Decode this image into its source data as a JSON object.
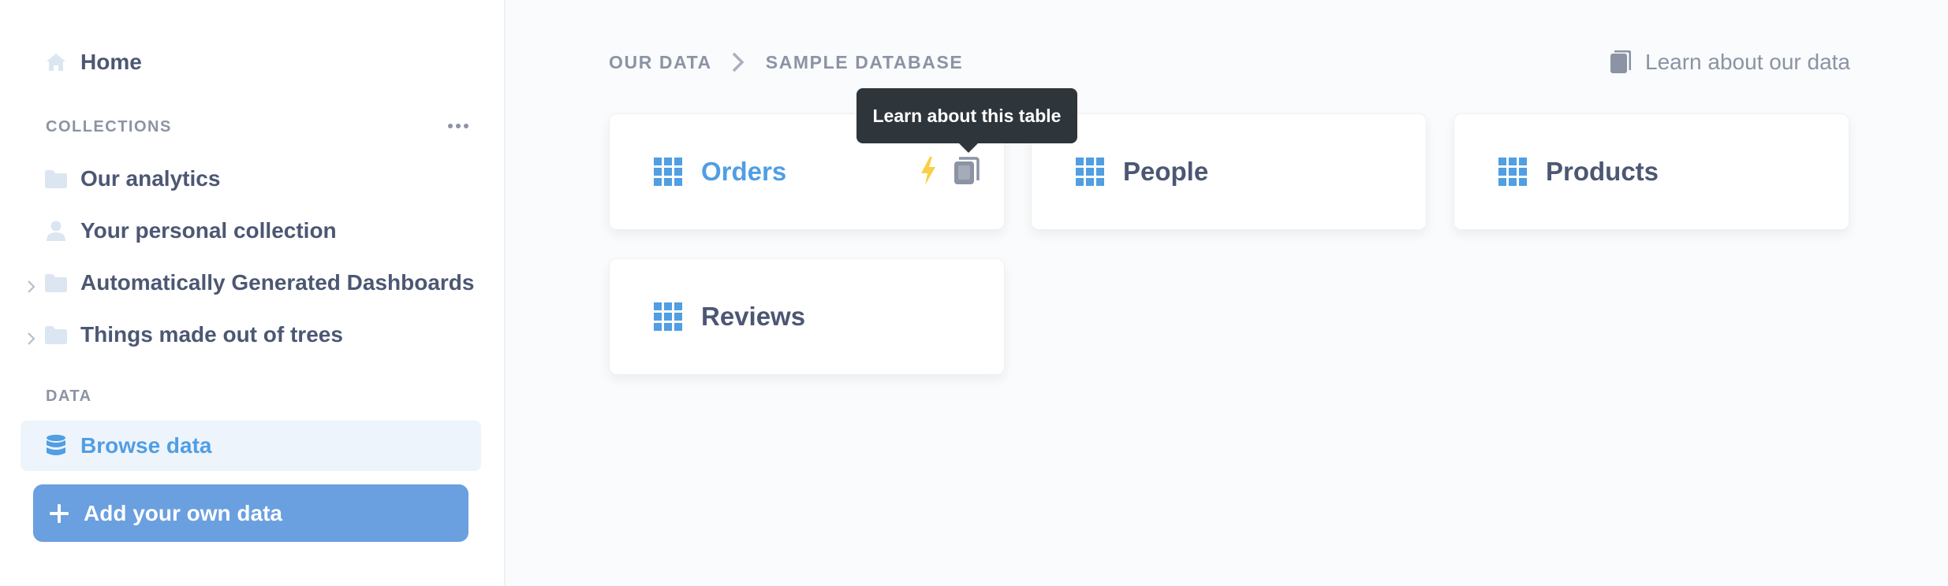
{
  "sidebar": {
    "home_label": "Home",
    "collections_heading": "COLLECTIONS",
    "collections": [
      {
        "label": "Our analytics",
        "icon": "folder-icon"
      },
      {
        "label": "Your personal collection",
        "icon": "person-icon"
      },
      {
        "label": "Automatically Generated Dashboards",
        "icon": "folder-icon",
        "expandable": true
      },
      {
        "label": "Things made out of trees",
        "icon": "folder-icon",
        "expandable": true
      }
    ],
    "data_heading": "DATA",
    "browse_label": "Browse data",
    "add_data_label": "Add your own data"
  },
  "breadcrumb": {
    "root": "OUR DATA",
    "current": "SAMPLE DATABASE"
  },
  "learn_link": "Learn about our data",
  "tooltip": "Learn about this table",
  "tables": [
    {
      "name": "Orders",
      "hovered": true
    },
    {
      "name": "People"
    },
    {
      "name": "Products"
    },
    {
      "name": "Reviews"
    }
  ],
  "colors": {
    "brand": "#509ee3",
    "button": "#6a9fe0",
    "text": "#4c5773",
    "muted": "#8b93a4",
    "bolt": "#f9cf48",
    "tooltip_bg": "#2e353b"
  }
}
